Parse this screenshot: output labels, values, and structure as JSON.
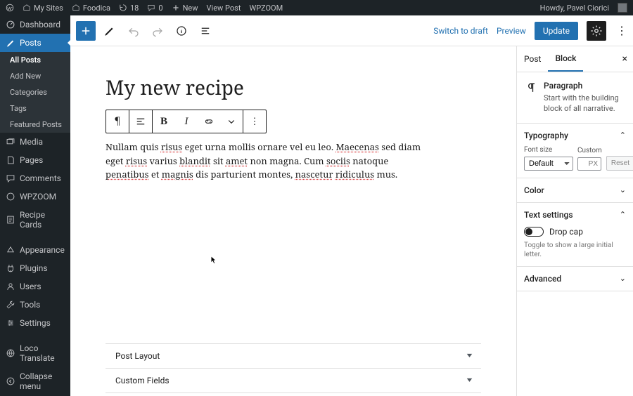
{
  "adminbar": {
    "my_sites": "My Sites",
    "site_name": "Foodica",
    "updates": "18",
    "comments": "0",
    "new": "New",
    "view_post": "View Post",
    "plugin": "WPZOOM",
    "howdy": "Howdy, Pavel Ciorici"
  },
  "sidebar": {
    "dashboard": "Dashboard",
    "posts": "Posts",
    "posts_sub": {
      "all": "All Posts",
      "add": "Add New",
      "cats": "Categories",
      "tags": "Tags",
      "feat": "Featured Posts"
    },
    "media": "Media",
    "pages": "Pages",
    "comments": "Comments",
    "wpzoom": "WPZOOM",
    "recipe_cards": "Recipe Cards",
    "appearance": "Appearance",
    "plugins": "Plugins",
    "users": "Users",
    "tools": "Tools",
    "settings": "Settings",
    "loco": "Loco Translate",
    "collapse": "Collapse menu"
  },
  "topbar": {
    "switch_draft": "Switch to draft",
    "preview": "Preview",
    "update": "Update"
  },
  "content": {
    "title": "My new recipe",
    "para_1a": "Nullam quis ",
    "para_1b": " eget urna mollis ornare vel eu leo. ",
    "para_1c": " sed diam eget ",
    "para_1d": " varius ",
    "para_1e": " sit ",
    "para_1f": " non magna. Cum ",
    "para_1g": " natoque ",
    "para_1h": " et ",
    "para_1i": " dis parturient montes, ",
    "para_1j": " mus.",
    "u_risus": "risus",
    "u_maecenas": "Maecenas",
    "u_risus2": "risus",
    "u_blandit": "blandit",
    "u_amet": "amet",
    "u_sociis": "sociis",
    "u_penatibus": "penatibus",
    "u_magnis": "magnis",
    "u_nascetur": "nascetur",
    "u_ridiculus": "ridiculus"
  },
  "meta": {
    "post_layout": "Post Layout",
    "custom_fields": "Custom Fields"
  },
  "inspector": {
    "tab_post": "Post",
    "tab_block": "Block",
    "block_name": "Paragraph",
    "block_desc": "Start with the building block of all narrative.",
    "typography": "Typography",
    "font_size": "Font size",
    "custom": "Custom",
    "default": "Default",
    "px": "PX",
    "reset": "Reset",
    "color": "Color",
    "text_settings": "Text settings",
    "drop_cap": "Drop cap",
    "drop_cap_help": "Toggle to show a large initial letter.",
    "advanced": "Advanced"
  }
}
